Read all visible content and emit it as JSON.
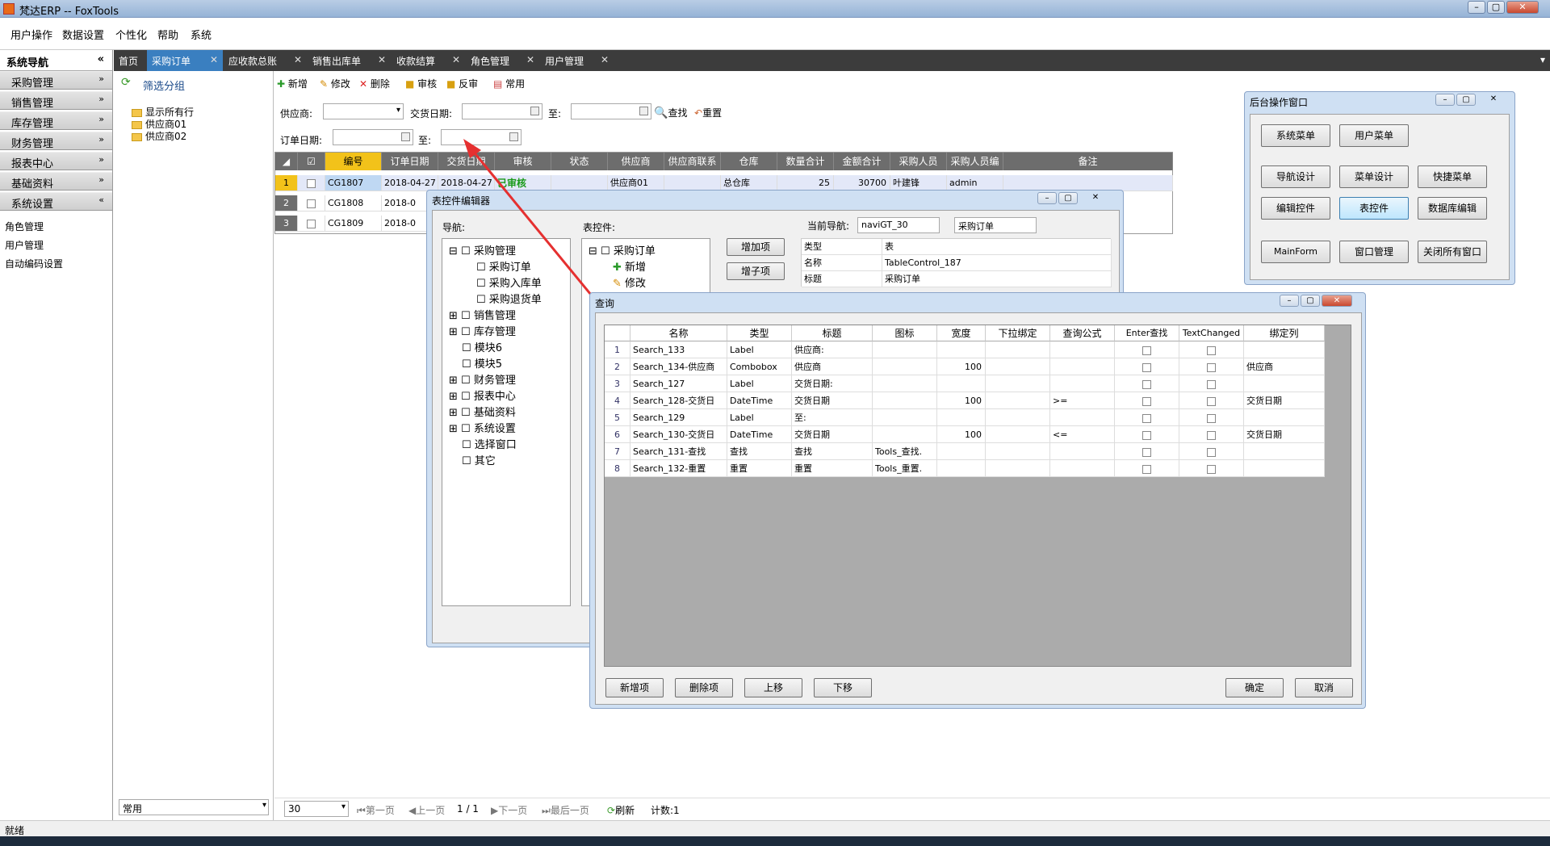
{
  "app": {
    "title": "梵达ERP -- FoxTools"
  },
  "menu": [
    "用户操作",
    "数据设置",
    "个性化",
    "帮助",
    "系统"
  ],
  "nav": {
    "title": "系统导航",
    "collapse_glyph": "«",
    "groups": [
      "采购管理",
      "销售管理",
      "库存管理",
      "财务管理",
      "报表中心",
      "基础资料",
      "系统设置"
    ],
    "expanded_sub": [
      "角色管理",
      "用户管理",
      "自动编码设置"
    ]
  },
  "tabs": [
    "首页",
    "采购订单",
    "应收款总账",
    "销售出库单",
    "收款结算",
    "角色管理",
    "用户管理"
  ],
  "filter": {
    "title": "筛选分组",
    "items": [
      "显示所有行",
      "供应商01",
      "供应商02"
    ],
    "bottom_select": "常用"
  },
  "toolbar": [
    "新增",
    "修改",
    "删除",
    "审核",
    "反审",
    "常用"
  ],
  "search": {
    "supplier_label": "供应商:",
    "delivery_label": "交货日期:",
    "to_label": "至:",
    "query_btn": "查找",
    "reset_btn": "重置",
    "order_date_label": "订单日期:",
    "to_label2": "至:"
  },
  "grid": {
    "columns": [
      "",
      "编号",
      "订单日期",
      "交货日期",
      "审核",
      "状态",
      "供应商",
      "供应商联系",
      "仓库",
      "数量合计",
      "金额合计",
      "采购人员",
      "采购人员编",
      "备注"
    ],
    "rows": [
      {
        "n": "1",
        "code": "CG1807",
        "odate": "2018-04-27",
        "ddate": "2018-04-27",
        "audit": "已审核",
        "supplier": "供应商01",
        "wh": "总仓库",
        "qty": "25",
        "amt": "30700",
        "buyer": "叶建锋",
        "buyerid": "admin"
      },
      {
        "n": "2",
        "code": "CG1808",
        "odate": "2018-0",
        "ddate": "",
        "audit": "",
        "supplier": "",
        "wh": "",
        "qty": "",
        "amt": "",
        "buyer": "",
        "buyerid": ""
      },
      {
        "n": "3",
        "code": "CG1809",
        "odate": "2018-0",
        "ddate": "",
        "audit": "",
        "supplier": "",
        "wh": "",
        "qty": "",
        "amt": "",
        "buyer": "",
        "buyerid": ""
      }
    ]
  },
  "pager": {
    "page_size": "30",
    "first": "第一页",
    "prev": "上一页",
    "page": "1 / 1",
    "next": "下一页",
    "last": "最后一页",
    "refresh": "刷新",
    "count": "计数:1"
  },
  "backend": {
    "title": "后台操作窗口",
    "buttons": [
      "系统菜单",
      "用户菜单",
      "导航设计",
      "菜单设计",
      "快捷菜单",
      "编辑控件",
      "表控件",
      "数据库编辑",
      "MainForm",
      "窗口管理",
      "关闭所有窗口"
    ]
  },
  "editor": {
    "title": "表控件编辑器",
    "nav_label": "导航:",
    "table_label": "表控件:",
    "current_nav_label": "当前导航:",
    "current_nav_value": "naviGT_30",
    "current_nav_name": "采购订单",
    "nav_tree": [
      "采购管理",
      "采购订单",
      "采购入库单",
      "采购退货单",
      "销售管理",
      "库存管理",
      "模块6",
      "模块5",
      "财务管理",
      "报表中心",
      "基础资料",
      "系统设置",
      "选择窗口",
      "其它"
    ],
    "table_tree": [
      "采购订单",
      "新增",
      "修改"
    ],
    "add_btn": "增加项",
    "add_sub_btn": "增子项",
    "props": [
      [
        "类型",
        "表"
      ],
      [
        "名称",
        "TableControl_187"
      ],
      [
        "标题",
        "采购订单"
      ]
    ]
  },
  "query": {
    "title": "查询",
    "columns": [
      "名称",
      "类型",
      "标题",
      "图标",
      "宽度",
      "下拉绑定",
      "查询公式",
      "Enter查找",
      "TextChanged",
      "绑定列"
    ],
    "rows": [
      [
        "1",
        "Search_133",
        "Label",
        "供应商:",
        "",
        "",
        "",
        "",
        "",
        "",
        ""
      ],
      [
        "2",
        "Search_134-供应商",
        "Combobox",
        "供应商",
        "",
        "100",
        "",
        "",
        "",
        "",
        "供应商"
      ],
      [
        "3",
        "Search_127",
        "Label",
        "交货日期:",
        "",
        "",
        "",
        "",
        "",
        "",
        ""
      ],
      [
        "4",
        "Search_128-交货日",
        "DateTime",
        "交货日期",
        "",
        "100",
        "",
        ">=",
        "",
        "",
        "交货日期"
      ],
      [
        "5",
        "Search_129",
        "Label",
        "至:",
        "",
        "",
        "",
        "",
        "",
        "",
        ""
      ],
      [
        "6",
        "Search_130-交货日",
        "DateTime",
        "交货日期",
        "",
        "100",
        "",
        "<=",
        "",
        "",
        "交货日期"
      ],
      [
        "7",
        "Search_131-查找",
        "查找",
        "查找",
        "Tools_查找.",
        "",
        "",
        "",
        "",
        "",
        ""
      ],
      [
        "8",
        "Search_132-重置",
        "重置",
        "重置",
        "Tools_重置.",
        "",
        "",
        "",
        "",
        "",
        ""
      ]
    ],
    "buttons": {
      "add": "新增项",
      "delete": "删除项",
      "up": "上移",
      "down": "下移",
      "ok": "确定",
      "cancel": "取消"
    }
  },
  "status": {
    "text": "就绪"
  }
}
